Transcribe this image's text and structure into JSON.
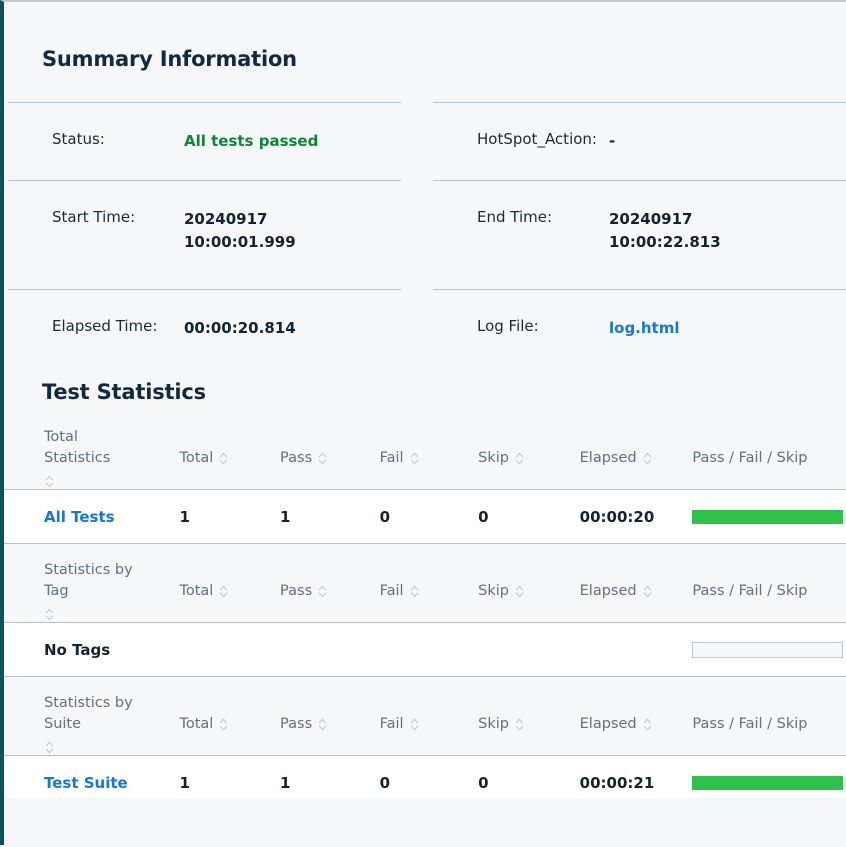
{
  "theme": {
    "accent_left_border": "#0b5361",
    "link_blue": "#1677e0",
    "pass_green": "#0b8835",
    "bar_green": "#2dc24a",
    "page_bg": "#f6f7f9",
    "row_bg": "#ffffff",
    "heading": "#102a43"
  },
  "summary": {
    "title": "Summary Information",
    "rows_left": [
      {
        "label": "Status:",
        "value": "All tests passed",
        "style": "pass"
      },
      {
        "label": "Start Time:",
        "value": "20240917 10:00:01.999",
        "style": "plain"
      },
      {
        "label": "Elapsed Time:",
        "value": "00:00:20.814",
        "style": "plain"
      }
    ],
    "rows_right": [
      {
        "label": "HotSpot_Action:",
        "value": "-",
        "style": "plain"
      },
      {
        "label": "End Time:",
        "value": "20240917 10:00:22.813",
        "style": "plain"
      },
      {
        "label": "Log File:",
        "value": "log.html",
        "style": "link"
      }
    ]
  },
  "statistics": {
    "title": "Test Statistics",
    "sort_icon": "sort-updown-icon",
    "common_columns": [
      "Total",
      "Pass",
      "Fail",
      "Skip",
      "Elapsed",
      "Pass / Fail / Skip"
    ],
    "tables": [
      {
        "id": "total",
        "name_header": "Total Statistics",
        "columns": [
          "Total",
          "Pass",
          "Fail",
          "Skip",
          "Elapsed",
          "Pass / Fail / Skip"
        ],
        "rows": [
          {
            "name": "All Tests",
            "name_is_link": true,
            "total": "1",
            "pass": "1",
            "fail": "0",
            "skip": "0",
            "elapsed": "00:00:20",
            "bar": {
              "pass_pct": 100,
              "fail_pct": 0,
              "skip_pct": 0,
              "empty": false
            }
          }
        ]
      },
      {
        "id": "tag",
        "name_header": "Statistics by Tag",
        "columns": [
          "Total",
          "Pass",
          "Fail",
          "Skip",
          "Elapsed",
          "Pass / Fail / Skip"
        ],
        "rows": [
          {
            "name": "No Tags",
            "name_is_link": false,
            "total": "",
            "pass": "",
            "fail": "",
            "skip": "",
            "elapsed": "",
            "bar": {
              "pass_pct": 0,
              "fail_pct": 0,
              "skip_pct": 0,
              "empty": true
            }
          }
        ]
      },
      {
        "id": "suite",
        "name_header": "Statistics by Suite",
        "columns": [
          "Total",
          "Pass",
          "Fail",
          "Skip",
          "Elapsed",
          "Pass / Fail / Skip"
        ],
        "rows": [
          {
            "name": "Test Suite",
            "name_is_link": true,
            "total": "1",
            "pass": "1",
            "fail": "0",
            "skip": "0",
            "elapsed": "00:00:21",
            "bar": {
              "pass_pct": 100,
              "fail_pct": 0,
              "skip_pct": 0,
              "empty": false
            }
          }
        ]
      }
    ]
  }
}
